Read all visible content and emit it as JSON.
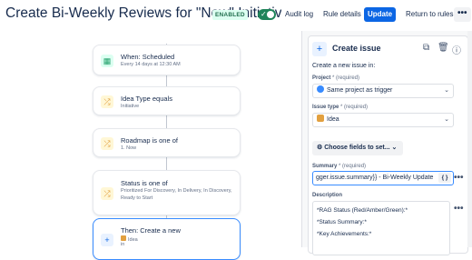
{
  "header": {
    "title": "Create Bi-Weekly Reviews for \"Now\" Initiatives",
    "badge": "ENABLED",
    "audit_log": "Audit log",
    "rule_details": "Rule details",
    "update": "Update",
    "return": "Return to rules",
    "more": "•••"
  },
  "flow": {
    "nodes": [
      {
        "title": "When: Scheduled",
        "subtitle": "Every 14 days at 12:30 AM",
        "icon": "calendar-icon"
      },
      {
        "title": "Idea Type equals",
        "subtitle": "Initiative",
        "icon": "condition-icon"
      },
      {
        "title": "Roadmap is one of",
        "subtitle": "1. Now",
        "icon": "condition-icon"
      },
      {
        "title": "Status is one of",
        "subtitle": "Prioritized For Discovery, In Delivery, In Discovery, Ready to Start",
        "icon": "condition-icon"
      },
      {
        "title": "Then: Create a new",
        "subtitle": "Idea",
        "subtitle2": "in",
        "icon": "plus-icon"
      }
    ]
  },
  "panel": {
    "title": "Create issue",
    "intro": "Create a new issue in:",
    "project_label": "Project",
    "project_req": "* (required)",
    "project_value": "Same project as trigger",
    "issue_type_label": "Issue type",
    "issue_type_req": "* (required)",
    "issue_type_value": "Idea",
    "choose_fields": "Choose fields to set...",
    "summary_label": "Summary",
    "summary_req": "* (required)",
    "summary_value": "gger.issue.summary}} - Bi-Weekly Update",
    "braces": "{ }",
    "description_label": "Description",
    "description_lines": [
      "*RAG Status (Red/Amber/Green):*",
      "*Status Summary:*",
      "*Key Achievements:*"
    ]
  },
  "colors": {
    "accent": "#0c66e4",
    "enabled": "#1f845a",
    "condition": "#e2a03f",
    "trigger": "#22a06b"
  }
}
